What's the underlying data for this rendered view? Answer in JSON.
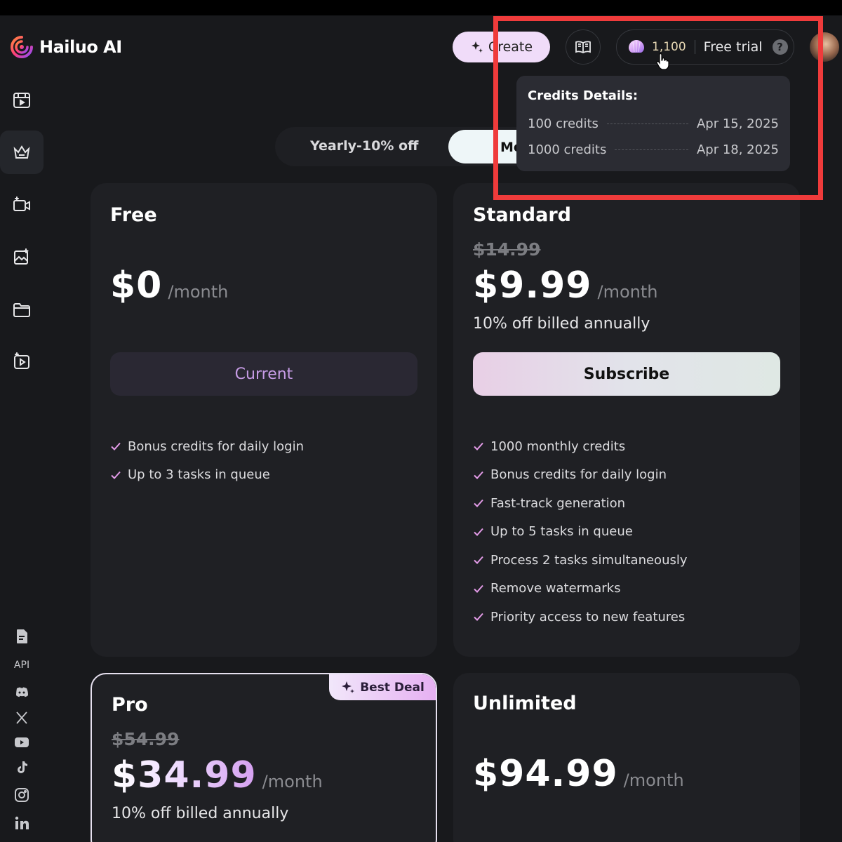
{
  "app": {
    "name": "Hailuo AI"
  },
  "header": {
    "create_label": "Create",
    "credits": "1,100",
    "trial_label": "Free trial",
    "help_label": "?"
  },
  "sidebar": {
    "api_label": "API"
  },
  "billing_toggle": {
    "yearly_label": "Yearly-10% off",
    "monthly_label": "Monthly"
  },
  "credits_popup": {
    "title": "Credits Details:",
    "rows": [
      {
        "amount": "100 credits",
        "expiry": "Apr 15, 2025"
      },
      {
        "amount": "1000 credits",
        "expiry": "Apr 18, 2025"
      }
    ]
  },
  "plans": [
    {
      "name": "Free",
      "price": "$0",
      "period": "/month",
      "cta": "Current",
      "features": [
        "Bonus credits for daily login",
        "Up to 3 tasks in queue"
      ]
    },
    {
      "name": "Standard",
      "old_price": "$14.99",
      "price": "$9.99",
      "period": "/month",
      "billed": "10% off billed annually",
      "cta": "Subscribe",
      "features": [
        "1000 monthly credits",
        "Bonus credits for daily login",
        "Fast-track generation",
        "Up to 5 tasks in queue",
        "Process 2 tasks simultaneously",
        "Remove watermarks",
        "Priority access to new features"
      ]
    },
    {
      "name": "Pro",
      "badge": "Best Deal",
      "old_price": "$54.99",
      "price": "$34.99",
      "period": "/month",
      "billed": "10% off billed annually"
    },
    {
      "name": "Unlimited",
      "price": "$94.99",
      "period": "/month"
    }
  ],
  "colors": {
    "accent": "#f0dcf9",
    "check": "#e39be8",
    "highlight_box": "#ef3b3b"
  }
}
